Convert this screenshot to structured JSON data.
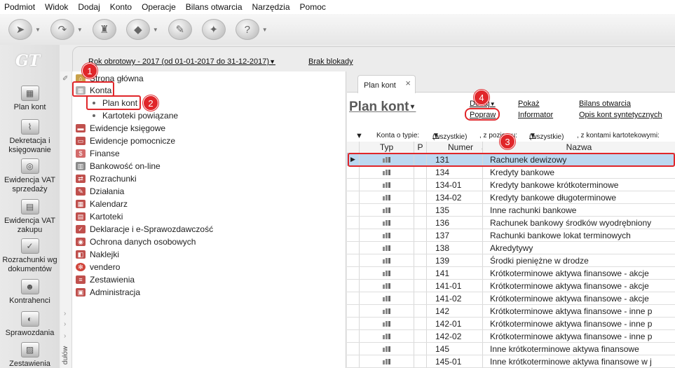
{
  "menu": [
    "Podmiot",
    "Widok",
    "Dodaj",
    "Konto",
    "Operacje",
    "Bilans otwarcia",
    "Narzędzia",
    "Pomoc"
  ],
  "toolbar": [
    {
      "icon": "pointer-icon"
    },
    {
      "icon": "forward-icon"
    },
    {
      "icon": "stamp-icon"
    },
    {
      "icon": "eraser-icon"
    },
    {
      "icon": "edit-icon"
    },
    {
      "icon": "clean-icon"
    },
    {
      "icon": "help-icon"
    }
  ],
  "logo": "GT",
  "modules": [
    {
      "label": "Plan kont"
    },
    {
      "label": "Dekretacja i księgowanie"
    },
    {
      "label": "Ewidencja VAT sprzedaży"
    },
    {
      "label": "Ewidencja VAT zakupu"
    },
    {
      "label": "Rozrachunki wg dokumentów"
    },
    {
      "label": "Kontrahenci"
    },
    {
      "label": "Sprawozdania"
    },
    {
      "label": "Zestawienia"
    }
  ],
  "header": {
    "rok": "Rok obrotowy - 2017  (od 01-01-2017 do 31-12-2017)",
    "blokada": "Brak blokady"
  },
  "nav_side_label": "dułów",
  "tree": [
    {
      "label": "Strona główna",
      "icon": "home-icon",
      "color": "#c9a24b"
    },
    {
      "label": "Konta",
      "icon": "accounts-icon",
      "color": "#b0b0b0"
    },
    {
      "label": "Plan kont",
      "icon": "bullet"
    },
    {
      "label": "Kartoteki powiązane",
      "icon": "bullet"
    },
    {
      "label": "Ewidencje księgowe",
      "icon": "ledger-icon",
      "color": "#c0504d"
    },
    {
      "label": "Ewidencje pomocnicze",
      "icon": "notebook-icon",
      "color": "#c0504d"
    },
    {
      "label": "Finanse",
      "icon": "finance-icon",
      "color": "#d36b6b"
    },
    {
      "label": "Bankowość on-line",
      "icon": "bank-icon",
      "color": "#8a8a8a"
    },
    {
      "label": "Rozrachunki",
      "icon": "settlements-icon",
      "color": "#c0504d"
    },
    {
      "label": "Działania",
      "icon": "actions-icon",
      "color": "#c0504d"
    },
    {
      "label": "Kalendarz",
      "icon": "calendar-icon",
      "color": "#c0504d"
    },
    {
      "label": "Kartoteki",
      "icon": "cards-icon",
      "color": "#c0504d"
    },
    {
      "label": "Deklaracje i e-Sprawozdawczość",
      "icon": "declarations-icon",
      "color": "#c0504d"
    },
    {
      "label": "Ochrona danych osobowych",
      "icon": "protection-icon",
      "color": "#c0504d"
    },
    {
      "label": "Naklejki",
      "icon": "stickers-icon",
      "color": "#c0504d"
    },
    {
      "label": "vendero",
      "icon": "vendero-icon",
      "color": "#d0463c"
    },
    {
      "label": "Zestawienia",
      "icon": "reports-icon",
      "color": "#c0504d"
    },
    {
      "label": "Administracja",
      "icon": "admin-icon",
      "color": "#c0504d"
    }
  ],
  "callouts": [
    "1",
    "2",
    "3",
    "4"
  ],
  "tab": {
    "label": "Plan kont",
    "close": "×"
  },
  "page": {
    "title": "Plan kont",
    "links": {
      "dodaj": "Dodaj",
      "popraw": "Popraw",
      "pokaz": "Pokaż",
      "informator": "Informator",
      "bilans": "Bilans otwarcia",
      "opis": "Opis kont syntetycznych"
    }
  },
  "filter": {
    "konta_label": "Konta o typie:",
    "konta_value": "(wszystkie)",
    "poziom_label": ", z poziomu:",
    "poziom_value": "(wszystkie)",
    "kartoteki_label": ", z kontami kartotekowymi:"
  },
  "table": {
    "columns": [
      "Typ",
      "P",
      "Numer",
      "Nazwa"
    ],
    "selected_row": 0,
    "rows": [
      {
        "numer": "131",
        "nazwa": "Rachunek dewizowy"
      },
      {
        "numer": "134",
        "nazwa": "Kredyty bankowe"
      },
      {
        "numer": "134-01",
        "nazwa": "Kredyty bankowe krótkoterminowe"
      },
      {
        "numer": "134-02",
        "nazwa": "Kredyty bankowe długoterminowe"
      },
      {
        "numer": "135",
        "nazwa": "Inne rachunki bankowe"
      },
      {
        "numer": "136",
        "nazwa": "Rachunek bankowy środków wyodrębniony"
      },
      {
        "numer": "137",
        "nazwa": "Rachunki bankowe lokat terminowych"
      },
      {
        "numer": "138",
        "nazwa": "Akredytywy"
      },
      {
        "numer": "139",
        "nazwa": "Środki pieniężne w drodze"
      },
      {
        "numer": "141",
        "nazwa": "Krótkoterminowe aktywa finansowe - akcje"
      },
      {
        "numer": "141-01",
        "nazwa": "Krótkoterminowe aktywa finansowe - akcje"
      },
      {
        "numer": "141-02",
        "nazwa": "Krótkoterminowe aktywa finansowe - akcje"
      },
      {
        "numer": "142",
        "nazwa": "Krótkoterminowe aktywa finansowe - inne p"
      },
      {
        "numer": "142-01",
        "nazwa": "Krótkoterminowe aktywa finansowe - inne p"
      },
      {
        "numer": "142-02",
        "nazwa": "Krótkoterminowe aktywa finansowe - inne p"
      },
      {
        "numer": "145",
        "nazwa": "Inne krótkoterminowe aktywa finansowe"
      },
      {
        "numer": "145-01",
        "nazwa": "Inne krótkoterminowe aktywa finansowe w j"
      }
    ]
  },
  "colors": {
    "callout": "#e0262a",
    "selection": "#bcd8f0"
  }
}
